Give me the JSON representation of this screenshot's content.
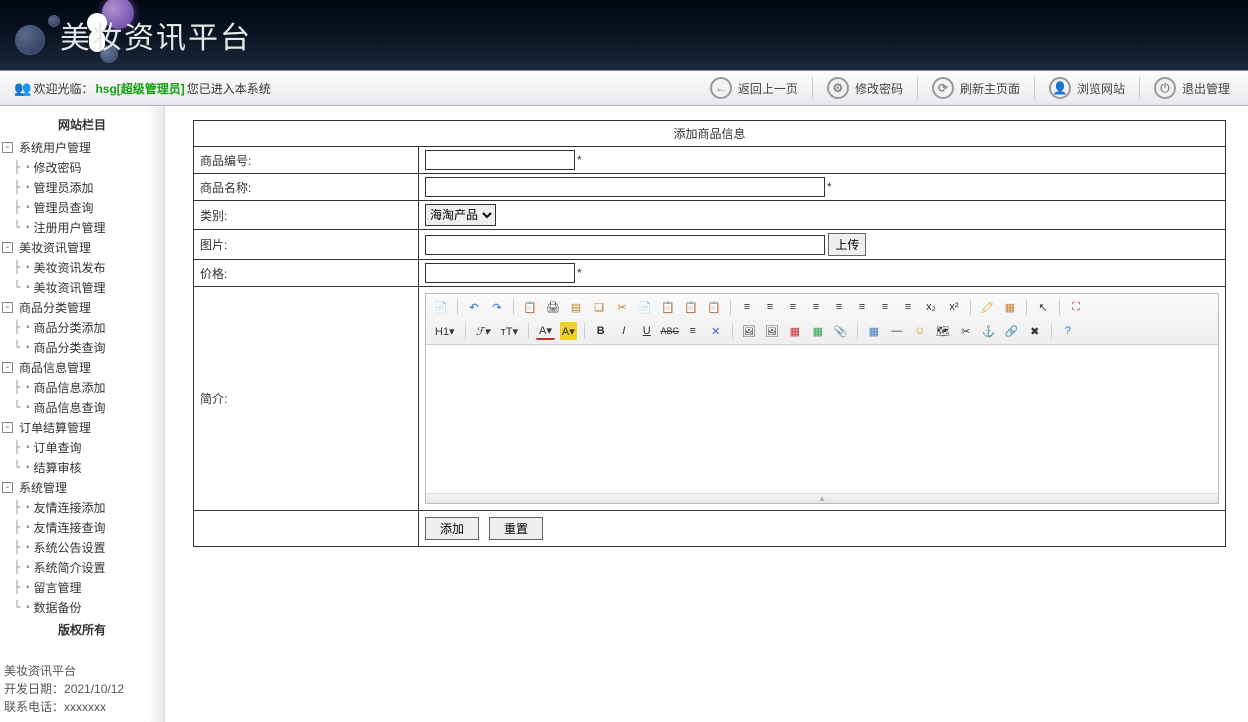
{
  "header": {
    "title": "美妆资讯平台"
  },
  "toolbar": {
    "welcome_prefix": "欢迎光临：",
    "welcome_user": "hsg[超级管理员]",
    "welcome_suffix": " 您已进入本系统",
    "actions": {
      "back": "返回上一页",
      "password": "修改密码",
      "refresh": "刷新主页面",
      "browse": "浏览网站",
      "logout": "退出管理"
    }
  },
  "sidebar": {
    "heading": "网站栏目",
    "groups": [
      {
        "label": "系统用户管理",
        "items": [
          "修改密码",
          "管理员添加",
          "管理员查询",
          "注册用户管理"
        ]
      },
      {
        "label": "美妆资讯管理",
        "items": [
          "美妆资讯发布",
          "美妆资讯管理"
        ]
      },
      {
        "label": "商品分类管理",
        "items": [
          "商品分类添加",
          "商品分类查询"
        ]
      },
      {
        "label": "商品信息管理",
        "items": [
          "商品信息添加",
          "商品信息查询"
        ]
      },
      {
        "label": "订单结算管理",
        "items": [
          "订单查询",
          "结算审核"
        ]
      },
      {
        "label": "系统管理",
        "items": [
          "友情连接添加",
          "友情连接查询",
          "系统公告设置",
          "系统简介设置",
          "留言管理",
          "数据备份"
        ]
      }
    ],
    "copyright_heading": "版权所有",
    "footer": {
      "line1": "美妆资讯平台",
      "line2_label": "开发日期：",
      "line2_value": "2021/10/12",
      "line3_label": "联系电话：",
      "line3_value": "xxxxxxx"
    }
  },
  "form": {
    "title": "添加商品信息",
    "product_code_label": "商品编号:",
    "product_name_label": "商品名称:",
    "category_label": "类别:",
    "category_selected": "海淘产品",
    "image_label": "图片:",
    "upload_btn": "上传",
    "price_label": "价格:",
    "intro_label": "简介:",
    "submit_btn": "添加",
    "reset_btn": "重置",
    "required_mark": "*"
  },
  "editor": {
    "row1": [
      {
        "n": "source-icon",
        "t": "📄"
      },
      {
        "sep": true
      },
      {
        "n": "undo-icon",
        "t": "↶",
        "c": "#2a6ad0"
      },
      {
        "n": "redo-icon",
        "t": "↷",
        "c": "#2a6ad0"
      },
      {
        "sep": true
      },
      {
        "n": "paste-icon",
        "t": "📋"
      },
      {
        "n": "print-icon",
        "t": "🖨"
      },
      {
        "n": "template-icon",
        "t": "▤",
        "c": "#c08020"
      },
      {
        "n": "clear-format-icon",
        "t": "❏",
        "c": "#c06020"
      },
      {
        "n": "cut-icon",
        "t": "✂",
        "c": "#c08020"
      },
      {
        "n": "copy-icon",
        "t": "📄"
      },
      {
        "n": "paste2-icon",
        "t": "📋"
      },
      {
        "n": "paste-word-icon",
        "t": "📋"
      },
      {
        "n": "paste-text-icon",
        "t": "📋"
      },
      {
        "sep": true
      },
      {
        "n": "align-left-icon",
        "t": "≡"
      },
      {
        "n": "align-center-icon",
        "t": "≡"
      },
      {
        "n": "align-right-icon",
        "t": "≡"
      },
      {
        "n": "align-justify-icon",
        "t": "≡"
      },
      {
        "n": "list-ol-icon",
        "t": "≡"
      },
      {
        "n": "list-ul-icon",
        "t": "≡"
      },
      {
        "n": "outdent-icon",
        "t": "≡"
      },
      {
        "n": "indent-icon",
        "t": "≡"
      },
      {
        "n": "subscript-icon",
        "t": "x₂"
      },
      {
        "n": "superscript-icon",
        "t": "x²"
      },
      {
        "sep": true
      },
      {
        "n": "highlight-icon",
        "t": "🖍",
        "c": "#d0a020"
      },
      {
        "n": "select-all-icon",
        "t": "▦",
        "c": "#c08030"
      },
      {
        "sep": true
      },
      {
        "n": "cursor-icon",
        "t": "↖"
      },
      {
        "sep": true
      },
      {
        "n": "fullscreen-icon",
        "t": "⛶",
        "c": "#c03030"
      }
    ],
    "row2": [
      {
        "n": "heading-icon",
        "t": "H1▾",
        "w": true
      },
      {
        "sep": true
      },
      {
        "n": "font-family-icon",
        "t": "ℱ▾",
        "w": true,
        "i": true
      },
      {
        "n": "font-size-icon",
        "t": "тT▾",
        "w": true
      },
      {
        "sep": true
      },
      {
        "n": "fore-color-icon",
        "t": "A▾",
        "w": true,
        "u": "#c03030"
      },
      {
        "n": "back-color-icon",
        "t": "A▾",
        "w": true,
        "bg": "#f0d020"
      },
      {
        "sep": true
      },
      {
        "n": "bold-icon",
        "t": "B",
        "b": true
      },
      {
        "n": "italic-icon",
        "t": "I",
        "i": true
      },
      {
        "n": "underline-icon",
        "t": "U",
        "ul": true
      },
      {
        "n": "strike-icon",
        "t": "ABC",
        "s": true
      },
      {
        "n": "line-height-icon",
        "t": "≡"
      },
      {
        "n": "remove-format-icon",
        "t": "✕",
        "c": "#4060c0"
      },
      {
        "sep": true
      },
      {
        "n": "image-icon",
        "t": "🖼"
      },
      {
        "n": "multi-image-icon",
        "t": "🖼"
      },
      {
        "n": "flash-icon",
        "t": "▦",
        "c": "#c03030"
      },
      {
        "n": "media-icon",
        "t": "▦",
        "c": "#30a050"
      },
      {
        "n": "attachment-icon",
        "t": "📎"
      },
      {
        "sep": true
      },
      {
        "n": "table-icon",
        "t": "▦",
        "c": "#4080c0"
      },
      {
        "n": "hr-icon",
        "t": "—"
      },
      {
        "n": "emoji-icon",
        "t": "☺",
        "c": "#d0a020"
      },
      {
        "n": "map-icon",
        "t": "🗺"
      },
      {
        "n": "page-break-icon",
        "t": "✂"
      },
      {
        "n": "anchor-icon",
        "t": "⚓",
        "c": "#888"
      },
      {
        "n": "link-icon",
        "t": "🔗"
      },
      {
        "n": "unlink-icon",
        "t": "✖"
      },
      {
        "sep": true
      },
      {
        "n": "about-icon",
        "t": "?",
        "c": "#3080d0"
      }
    ]
  }
}
